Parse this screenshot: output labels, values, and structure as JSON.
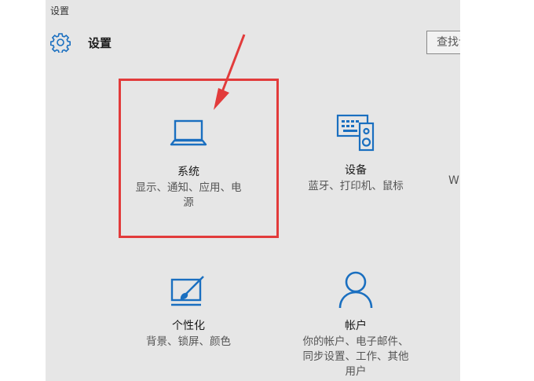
{
  "window": {
    "title": "设置"
  },
  "header": {
    "title": "设置",
    "icon": "gear-icon"
  },
  "search": {
    "placeholder": "查找设置"
  },
  "tiles": [
    {
      "name": "系统",
      "desc_line1": "显示、通知、应用、电",
      "desc_line2": "源",
      "icon": "laptop-icon"
    },
    {
      "name": "设备",
      "desc_line1": "蓝牙、打印机、鼠标",
      "icon": "devices-icon"
    },
    {
      "name": "个性化",
      "desc_line1": "背景、锁屏、颜色",
      "icon": "personalization-icon"
    },
    {
      "name": "帐户",
      "desc_line1": "你的帐户、电子邮件、",
      "desc_line2": "同步设置、工作、其他",
      "desc_line3": "用户",
      "icon": "person-icon"
    }
  ],
  "partial_tile": {
    "text": "W"
  },
  "colors": {
    "accent": "#1a6fc0",
    "window_bg": "#e6e6e6",
    "annotation": "#e23b3b"
  }
}
